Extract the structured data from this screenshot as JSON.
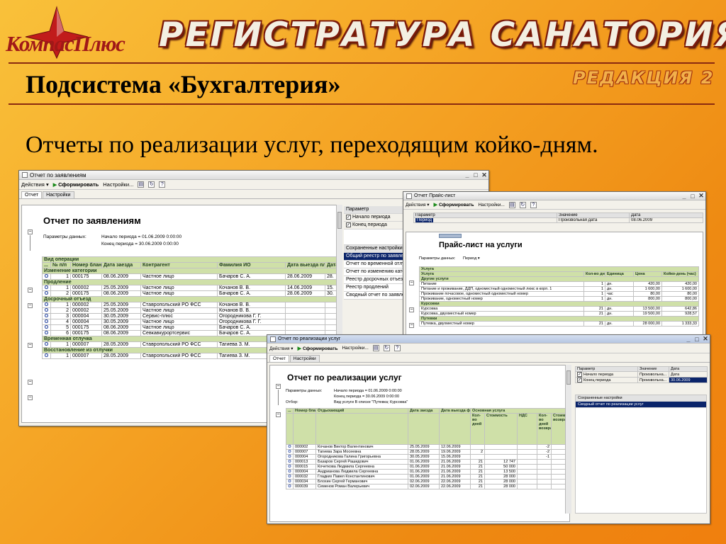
{
  "header": {
    "logo": "КомпасПлюс",
    "title": "РЕГИСТРАТУРА САНАТОРИЯ",
    "edition": "РЕДАКЦИЯ 2",
    "slide_title": "Подсистема «Бухгалтерия»",
    "subtitle": "Отчеты по реализации услуг, переходящим койко-дням."
  },
  "colors": {
    "accent": "#a01818",
    "grid_header": "#cfe0a8",
    "selection": "#0a246a"
  },
  "icons": [
    "minimize-icon",
    "maximize-icon",
    "close-icon",
    "run-icon",
    "refresh-icon",
    "help-icon",
    "checkbox-icon"
  ],
  "w1": {
    "title": "Отчет по заявлениям",
    "tb": {
      "actions": "Действия ▾",
      "run": "Сформировать",
      "settings": "Настройки..."
    },
    "tabs": [
      "Отчет",
      "Настройки"
    ],
    "report_title": "Отчет по заявлениям",
    "params_label": "Параметры данных:",
    "period_start": "Начало периода = 01.06.2009 0:00:00",
    "period_end": "Конец периода = 30.06.2009 0:00:00",
    "group_top": "Вид операции",
    "cols": [
      "...",
      "№ п/п",
      "Номер бланка",
      "Дата заезда",
      "Контрагент",
      "Фамилия ИО",
      "Дата выезда план",
      "Дата вы фа"
    ],
    "groups": [
      {
        "name": "Изменение категории",
        "rows": [
          [
            "1",
            "000175",
            "08.06.2009",
            "Частное лицо",
            "Бачаров С. А.",
            "28.06.2009",
            "28."
          ]
        ]
      },
      {
        "name": "Продление",
        "rows": [
          [
            "1",
            "000002",
            "25.05.2009",
            "Частное лицо",
            "Кочанов В. В.",
            "14.06.2009",
            "15."
          ],
          [
            "2",
            "000175",
            "08.06.2009",
            "Частное лицо",
            "Бачаров С. А.",
            "28.06.2009",
            "30."
          ]
        ]
      },
      {
        "name": "Досрочный отъезд",
        "rows": [
          [
            "1",
            "000002",
            "25.05.2009",
            "Ставропольский РО ФСС",
            "Кочанов В. В.",
            "",
            ""
          ],
          [
            "2",
            "000002",
            "25.05.2009",
            "Частное лицо",
            "Кочанов В. В.",
            "",
            ""
          ],
          [
            "3",
            "000004",
            "30.05.2009",
            "Сервис-плюс",
            "Огородникова Г. Г.",
            "",
            ""
          ],
          [
            "4",
            "000004",
            "30.05.2009",
            "Частное лицо",
            "Огородникова Г. Г.",
            "",
            ""
          ],
          [
            "5",
            "000175",
            "08.06.2009",
            "Частное лицо",
            "Бачаров С. А.",
            "",
            ""
          ],
          [
            "6",
            "000175",
            "08.06.2009",
            "Севкавкурортсервис",
            "Бачаров С. А.",
            "",
            ""
          ]
        ]
      },
      {
        "name": "Временная отлучка",
        "rows": [
          [
            "1",
            "000007",
            "28.05.2009",
            "Ставропольский РО ФСС",
            "Тагиева З. М.",
            "",
            ""
          ]
        ]
      },
      {
        "name": "Восстановление из отлучки",
        "rows": [
          [
            "1",
            "000007",
            "28.05.2009",
            "Ставропольский РО ФСС",
            "Тагиева З. М.",
            "",
            ""
          ]
        ]
      }
    ],
    "param_header": "Параметр",
    "params": [
      "Начало периода",
      "Конец периода"
    ],
    "saved_header": "Сохраненные настройки",
    "saved": [
      "Общий реестр по заявлениям",
      "Отчет по временной отлучке",
      "Отчет по изменению категории",
      "Реестр досрочных отъездов",
      "Реестр продлений",
      "Сводный отчет по заявлениям"
    ]
  },
  "w2": {
    "title": "Отчет  Прайс-лист",
    "tb": {
      "actions": "Действия ▾",
      "run": "Сформировать",
      "settings": "Настройки..."
    },
    "ph": [
      "Параметр",
      "Значение",
      "Дата"
    ],
    "prow": [
      "Период",
      "Произвольная дата",
      "08.06.2009"
    ],
    "report_title": "Прайс-лист на услуги",
    "params_label": "Параметры данных:",
    "params_val": "Период ▾",
    "cols": [
      "Услуга",
      "Кол-во дней",
      "Единица",
      "Цена",
      "Койко-день (час)"
    ],
    "group_top": "Услуга",
    "groups": [
      {
        "name": "Другие услуги",
        "rows": [
          [
            "Питание",
            "1",
            "дн.",
            "420,00",
            "420,00"
          ],
          [
            "Питание и проживание, ДДП, одноместный одноместный люкс в корп. 1",
            "1",
            "дн.",
            "1 600,00",
            "1 600,00"
          ],
          [
            "Проживание почасовое, одноместный одноместный номер",
            "1",
            "час",
            "80,00",
            "80,00"
          ],
          [
            "Проживание, одноместный номер",
            "1",
            "дн.",
            "800,00",
            "800,00"
          ]
        ]
      },
      {
        "name": "Курсовки",
        "rows": [
          [
            "Курсовка",
            "21",
            "дн.",
            "13 500,00",
            "642,86"
          ],
          [
            "Курсовка, двухместный номер",
            "21",
            "дн.",
            "19 500,00",
            "928,57"
          ]
        ]
      },
      {
        "name": "Путевки",
        "rows": [
          [
            "Путевка, двухместный номер",
            "21",
            "дн.",
            "28 000,00",
            "1 333,33"
          ]
        ]
      }
    ]
  },
  "w3": {
    "title": "Отчет по реализации услуг",
    "tb": {
      "actions": "Действия ▾",
      "run": "Сформировать",
      "settings": "Настройки..."
    },
    "tabs": [
      "Отчет",
      "Настройки"
    ],
    "report_title": "Отчет по реализации услуг",
    "params_label": "Параметры данных:",
    "period_start": "Начало периода = 01.06.2009 0:00:00",
    "period_end": "Конец периода = 30.06.2009 0:00:00",
    "filter_label": "Отбор:",
    "filter_val": "Вид услуги В списке \"Путевка; Курсовка\"",
    "cols": [
      "Номер бланка",
      "Отдыхающий",
      "Дата заезда",
      "Дата выезда факт",
      "Кол-во дней",
      "Стоимость",
      "НДС",
      "Кол-во дней возврат",
      "Стоимость возврата"
    ],
    "basic_service": "Основная услуга",
    "rows": [
      [
        "000002",
        "Кочанов Виктор Валентинович",
        "25.05.2009",
        "12.06.2009",
        "",
        "",
        "",
        "-2",
        ""
      ],
      [
        "000007",
        "Тагиева Зара Мосеевна",
        "28.05.2009",
        "19.06.2009",
        "2",
        "",
        "",
        "-2",
        ""
      ],
      [
        "000004",
        "Огородникова Галина Григорьевна",
        "30.05.2009",
        "15.06.2009",
        "",
        "",
        "",
        "-1",
        ""
      ],
      [
        "000013",
        "Базаров Сергей Рашидович",
        "01.06.2009",
        "21.06.2009",
        "21",
        "12 747",
        "",
        "",
        ""
      ],
      [
        "000015",
        "Кочеткова Людмила Сергеевна",
        "01.06.2009",
        "21.06.2009",
        "21",
        "50 000",
        "",
        "",
        ""
      ],
      [
        "000004",
        "Андрианова Людмила Сергеевна",
        "01.06.2009",
        "21.06.2009",
        "21",
        "13 500",
        "",
        "",
        ""
      ],
      [
        "000032",
        "Гладких Павел Константинович",
        "01.06.2009",
        "21.06.2009",
        "21",
        "28 000",
        "",
        "",
        ""
      ],
      [
        "000034",
        "Блохин Сергей Германович",
        "02.06.2009",
        "22.06.2009",
        "21",
        "28 000",
        "",
        "",
        ""
      ],
      [
        "000039",
        "Семенов Роман Валерьевич",
        "02.06.2009",
        "22.06.2009",
        "21",
        "28 000",
        "",
        "",
        ""
      ]
    ],
    "ph": [
      "Параметр",
      "Значение",
      "Дата"
    ],
    "params": [
      [
        "Начало периода",
        "Произвольна...",
        "Дата"
      ],
      [
        "Конец периода",
        "Произвольна...",
        "30.06.2009"
      ]
    ],
    "saved_header": "Сохраненные настройки",
    "saved": [
      "Сводный отчет по реализации услуг"
    ]
  }
}
